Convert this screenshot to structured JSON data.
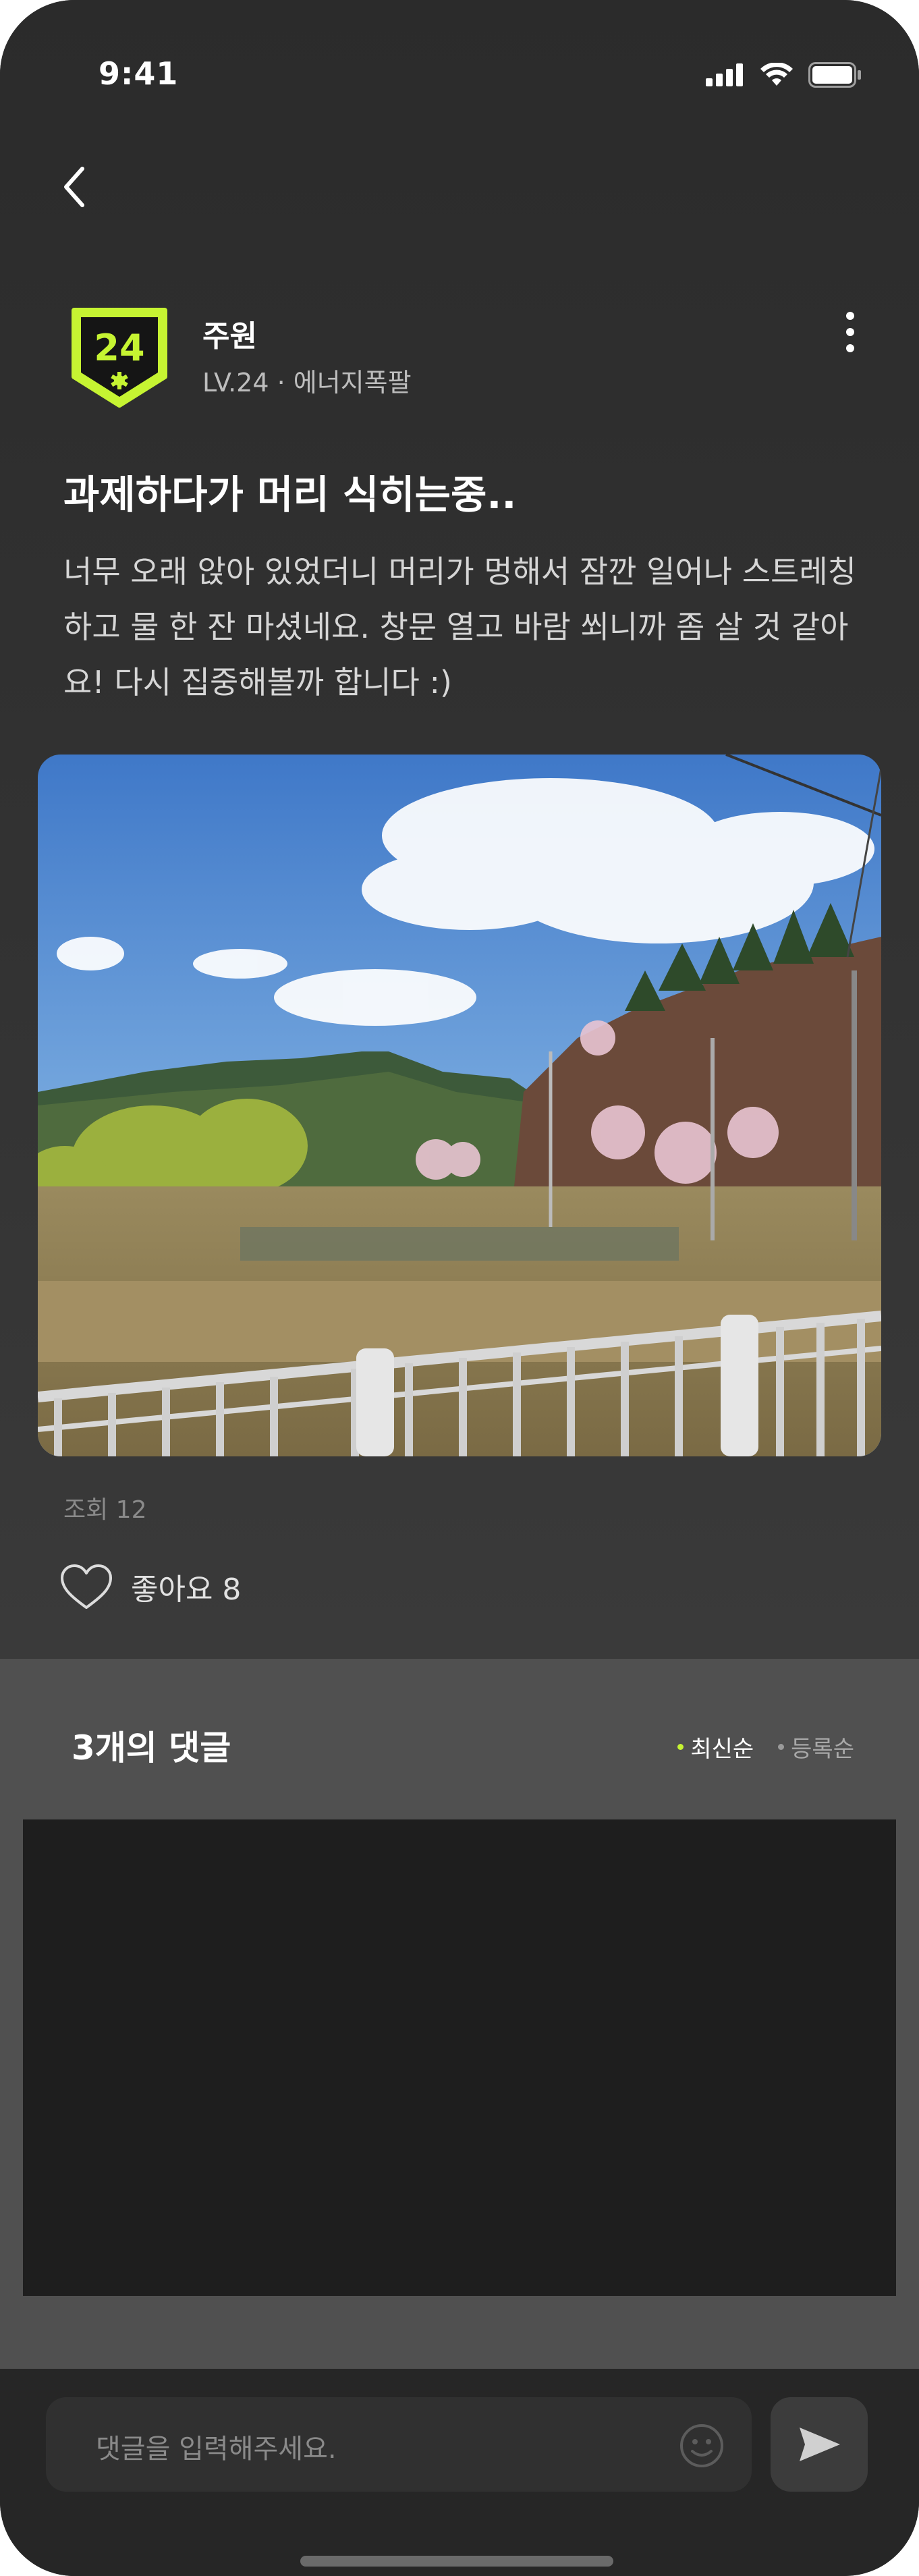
{
  "status": {
    "time": "9:41"
  },
  "post": {
    "author": {
      "name": "주원",
      "meta": "LV.24 · 에너지폭팔",
      "badge_number": "24"
    },
    "title": "과제하다가 머리 식히는중..",
    "body": "너무 오래 앉아 있었더니 머리가 멍해서 잠깐 일어나 스트레칭하고 물 한 잔 마셨네요. 창문 열고 바람 쐬니까 좀 살 것 같아요! 다시 집중해볼까 합니다 :)",
    "views": "조회 12",
    "likes": "좋아요 8"
  },
  "comments": {
    "title": "3개의 댓글",
    "sort": [
      "최신순",
      "등록순"
    ]
  },
  "input": {
    "placeholder": "댓글을 입력해주세요."
  },
  "colors": {
    "accent": "#C6F432",
    "background": "#2a2a2a"
  }
}
